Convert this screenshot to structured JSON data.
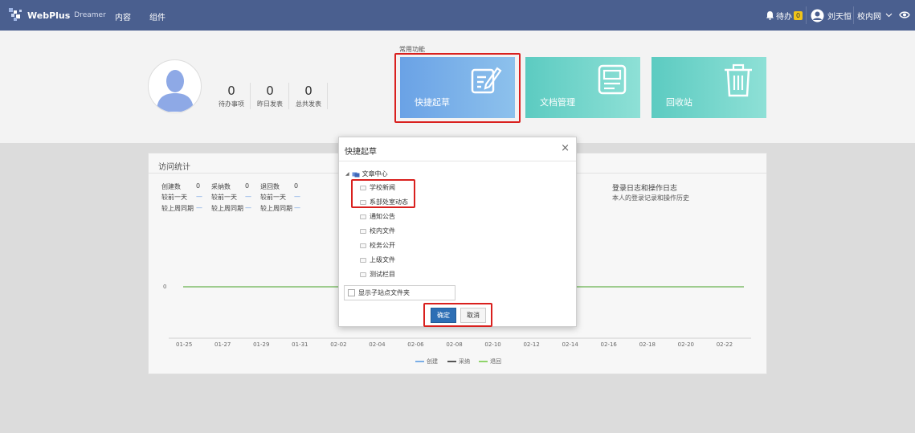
{
  "header": {
    "logo_text": "WebPlus",
    "logo_sub": "Dreamer",
    "nav": [
      "内容",
      "组件"
    ],
    "todo_label": "待办",
    "todo_count": "0",
    "user_name": "刘天恒",
    "site_label": "校内网"
  },
  "profile": {
    "stats": [
      {
        "value": "0",
        "label": "待办事项"
      },
      {
        "value": "0",
        "label": "昨日发表"
      },
      {
        "value": "0",
        "label": "总共发表"
      }
    ]
  },
  "common": {
    "label": "常用功能",
    "tiles": [
      {
        "label": "快捷起草",
        "color": "#6fa6e6"
      },
      {
        "label": "文档管理",
        "color": "#5fcfc4"
      },
      {
        "label": "回收站",
        "color": "#5fcfc4"
      }
    ]
  },
  "visit_stats": {
    "title": "访问统计",
    "metrics": [
      {
        "name": "创建数",
        "value": "0",
        "day": "较前一天",
        "week": "较上周同期"
      },
      {
        "name": "采纳数",
        "value": "0",
        "day": "较前一天",
        "week": "较上周同期"
      },
      {
        "name": "退回数",
        "value": "0",
        "day": "较前一天",
        "week": "较上周同期"
      }
    ],
    "dash": "—",
    "log_title": "登录日志和操作日志",
    "log_sub": "本人的登录记录和操作历史"
  },
  "chart_data": {
    "type": "line",
    "x": [
      "01-25",
      "01-27",
      "01-29",
      "01-31",
      "02-02",
      "02-04",
      "02-06",
      "02-08",
      "02-10",
      "02-12",
      "02-14",
      "02-16",
      "02-18",
      "02-20",
      "02-22"
    ],
    "y_tick": "0",
    "series": [
      {
        "name": "创建",
        "color": "#7aaee6"
      },
      {
        "name": "采纳",
        "color": "#555555"
      },
      {
        "name": "退回",
        "color": "#8fd46a"
      }
    ]
  },
  "modal": {
    "title": "快捷起草",
    "close": "×",
    "root": "文章中心",
    "folders": [
      "学校新闻",
      "系部处室动态",
      "通知公告",
      "校内文件",
      "校务公开",
      "上级文件",
      "测试栏目"
    ],
    "show_sub": "显示子站点文件夹",
    "ok": "确定",
    "cancel": "取消"
  }
}
